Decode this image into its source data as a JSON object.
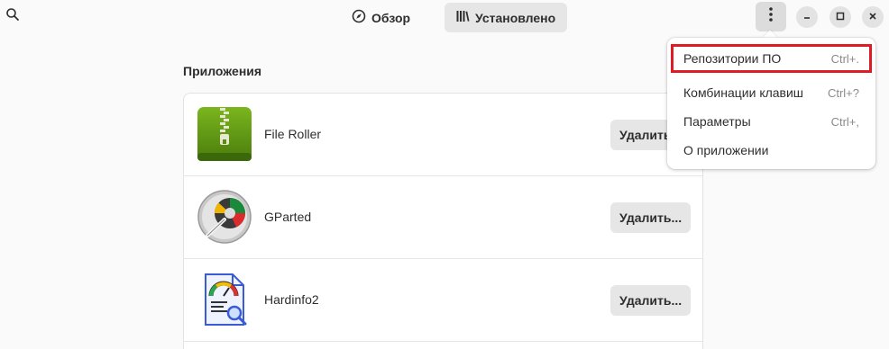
{
  "header": {
    "tabs": [
      {
        "label": "Обзор",
        "icon": "compass-icon",
        "active": false
      },
      {
        "label": "Установлено",
        "icon": "library-icon",
        "active": true
      }
    ]
  },
  "main": {
    "section_title": "Приложения",
    "apps": [
      {
        "name": "File Roller",
        "icon": "archive-icon",
        "action": "Удалить"
      },
      {
        "name": "GParted",
        "icon": "disk-gauge-icon",
        "action": "Удалить..."
      },
      {
        "name": "Hardinfo2",
        "icon": "system-info-icon",
        "action": "Удалить..."
      }
    ]
  },
  "menu": {
    "items": [
      {
        "label": "Репозитории ПО",
        "accel": "Ctrl+."
      },
      {
        "label": "Комбинации клавиш",
        "accel": "Ctrl+?"
      },
      {
        "label": "Параметры",
        "accel": "Ctrl+,"
      },
      {
        "label": "О приложении",
        "accel": ""
      }
    ]
  },
  "colors": {
    "accent_highlight": "#e01b24",
    "button_bg": "#e6e6e6",
    "window_bg": "#fafafa"
  }
}
